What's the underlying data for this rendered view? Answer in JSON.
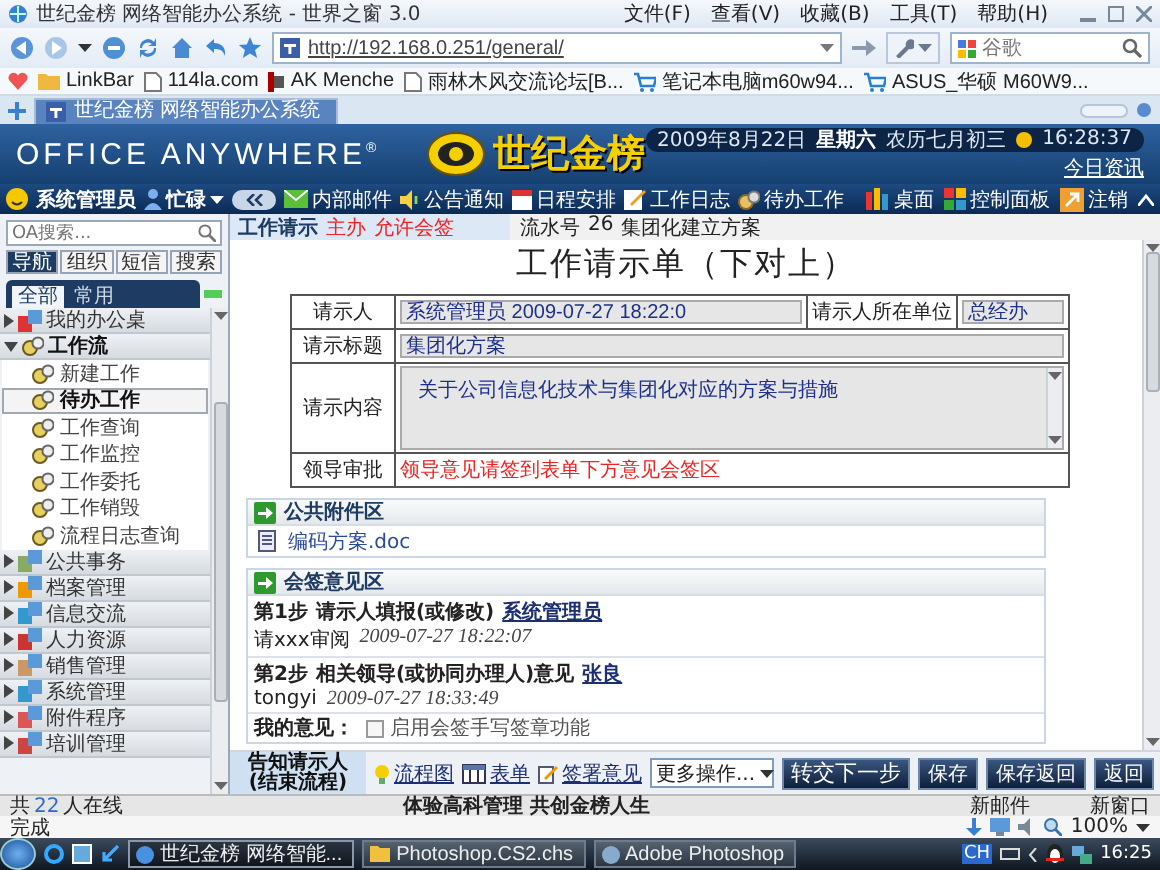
{
  "browser": {
    "title": "世纪金榜 网络智能办公系统 - 世界之窗 3.0",
    "menu": [
      "文件(F)",
      "查看(V)",
      "收藏(B)",
      "工具(T)",
      "帮助(H)"
    ],
    "address": "http://192.168.0.251/general/",
    "search_placeholder": "谷歌",
    "bookmarks": [
      "LinkBar",
      "114la.com",
      "AK Menche",
      "雨林木风交流论坛[B...",
      "笔记本电脑m60w94...",
      "ASUS_华硕 M60W9..."
    ],
    "tabs": [
      {
        "label": "世纪金榜 网络智能办公系统",
        "selected": true
      }
    ],
    "status": "完成",
    "zoom": "100%"
  },
  "header": {
    "product": "OFFICE ANYWHERE$^{®}$",
    "brand": "世纪金榜",
    "date": "2009年8月22日",
    "weekday": "星期六",
    "lunar": "农历七月初三",
    "time": "16:28:37",
    "news_link": "今日资讯"
  },
  "toolbar": {
    "user": "系统管理员",
    "status": "忙碌",
    "items": [
      "内部邮件",
      "公告通知",
      "日程安排",
      "工作日志",
      "待办工作"
    ],
    "right_items": [
      "桌面",
      "控制面板",
      "注销"
    ]
  },
  "sidebar": {
    "search_placeholder": "OA搜索...",
    "tabs": [
      {
        "label": "导航",
        "selected": true
      },
      {
        "label": "组织",
        "selected": false
      },
      {
        "label": "短信",
        "selected": false
      },
      {
        "label": "搜索",
        "selected": false
      }
    ],
    "subtabs": [
      {
        "label": "全部",
        "selected": true
      },
      {
        "label": "常用",
        "selected": false
      }
    ],
    "menu": [
      {
        "label": "我的办公桌",
        "expanded": false
      },
      {
        "label": "工作流",
        "expanded": true,
        "children": [
          {
            "label": "新建工作",
            "selected": false
          },
          {
            "label": "待办工作",
            "selected": true
          },
          {
            "label": "工作查询",
            "selected": false
          },
          {
            "label": "工作监控",
            "selected": false
          },
          {
            "label": "工作委托",
            "selected": false
          },
          {
            "label": "工作销毁",
            "selected": false
          },
          {
            "label": "流程日志查询",
            "selected": false
          }
        ]
      },
      {
        "label": "公共事务",
        "expanded": false
      },
      {
        "label": "档案管理",
        "expanded": false
      },
      {
        "label": "信息交流",
        "expanded": false
      },
      {
        "label": "人力资源",
        "expanded": false
      },
      {
        "label": "销售管理",
        "expanded": false
      },
      {
        "label": "系统管理",
        "expanded": false
      },
      {
        "label": "附件程序",
        "expanded": false
      },
      {
        "label": "培训管理",
        "expanded": false
      }
    ]
  },
  "form": {
    "type": "工作请示",
    "role": "主办",
    "permission": "允许会签",
    "serial_label": "流水号",
    "serial": "26",
    "flow_name": "集团化建立方案",
    "title": "工作请示单（下对上）",
    "requester_label": "请示人",
    "requester": "系统管理员 2009-07-27 18:22:0",
    "dept_label": "请示人所在单位",
    "dept": "总经办",
    "subject_label": "请示标题",
    "subject": "集团化方案",
    "content_label": "请示内容",
    "content": "关于公司信息化技术与集团化对应的方案与措施",
    "approval_label": "领导审批",
    "approval_note": "领导意见请签到表单下方意见会签区"
  },
  "attachments": {
    "title": "公共附件区",
    "files": [
      "编码方案.doc"
    ]
  },
  "countersign": {
    "title": "会签意见区",
    "steps": [
      {
        "step": "第1步",
        "name": "请示人填报(或修改)",
        "user": "系统管理员",
        "comment": "请xxx审阅",
        "time": "2009-07-27 18:22:07"
      },
      {
        "step": "第2步",
        "name": "相关领导(或协同办理人)意见",
        "user": "张良",
        "comment": "tongyi",
        "time": "2009-07-27 18:33:49"
      }
    ],
    "my_label": "我的意见：",
    "handwriting": {
      "label": "启用会签手写签章功能",
      "checked": false
    }
  },
  "actions": {
    "notify": "告知请示人 (结束流程)",
    "links": [
      "流程图",
      "表单",
      "签署意见"
    ],
    "more": "更多操作...",
    "primary": "转交下一步",
    "buttons": [
      "保存",
      "保存返回",
      "返回"
    ]
  },
  "status": {
    "online_prefix": "共",
    "online_count": "22",
    "online_suffix": "人在线",
    "slogan": "体验高科管理 共创金榜人生",
    "links": [
      "新邮件",
      "新窗口"
    ]
  },
  "taskbar": {
    "windows": [
      {
        "label": "世纪金榜 网络智能...",
        "selected": true
      },
      {
        "label": "Photoshop.CS2.chs",
        "selected": false
      },
      {
        "label": "Adobe Photoshop",
        "selected": false
      }
    ],
    "input_method": "CH",
    "clock": "16:25"
  }
}
